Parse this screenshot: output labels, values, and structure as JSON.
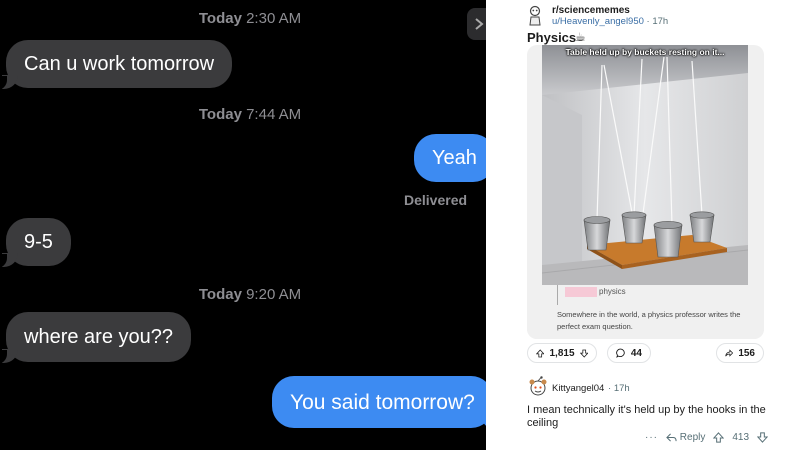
{
  "chat": {
    "timestamps": [
      {
        "day": "Today",
        "time": "2:30 AM"
      },
      {
        "day": "Today",
        "time": "7:44 AM"
      },
      {
        "day": "Today",
        "time": "9:20 AM"
      }
    ],
    "messages": [
      {
        "from": "them",
        "text": "Can u work tomorrow"
      },
      {
        "from": "me",
        "text": "Yeah"
      },
      {
        "from": "them",
        "text": "9-5"
      },
      {
        "from": "them",
        "text": "where are you??"
      },
      {
        "from": "me",
        "text": "You said tomorrow?"
      }
    ],
    "delivered_label": "Delivered",
    "colors": {
      "incoming": "#3b3b3d",
      "outgoing": "#3d8bf2",
      "background": "#000000"
    }
  },
  "post": {
    "subreddit": "r/sciencememes",
    "author": "u/Heavenly_angel950",
    "age": "17h",
    "title": "Physics",
    "title_emoji": "☕",
    "image": {
      "caption": "Table held up by buckets resting on it...",
      "tag": "physics",
      "description_text": "Somewhere in the world, a physics professor writes the perfect exam question."
    },
    "upvotes": "1,815",
    "comments": "44",
    "shares": "156"
  },
  "comment": {
    "author": "Kittyangel04",
    "age": "17h",
    "body": "I mean technically it's held up by the hooks in the ceiling",
    "more_label": "···",
    "reply_label": "Reply",
    "score": "413"
  },
  "icons": {
    "upvote": "arrow-up-icon",
    "downvote": "arrow-down-icon",
    "comment": "speech-bubble-icon",
    "share": "share-arrow-icon",
    "reply": "reply-arrow-icon"
  }
}
